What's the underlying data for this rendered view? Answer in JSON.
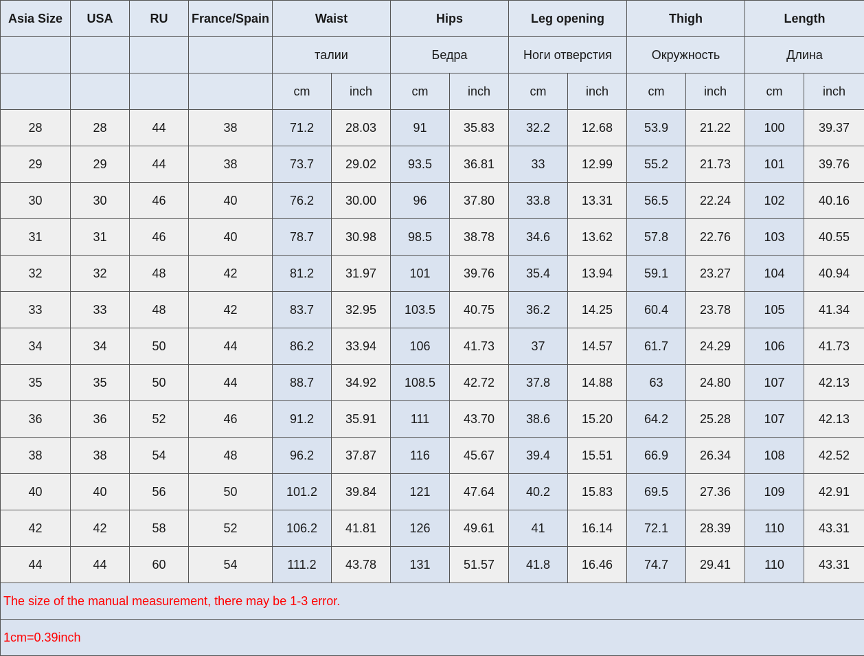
{
  "colors": {
    "header_bg": "#dfe7f2",
    "cell_gray": "#efefef",
    "cell_blue": "#dae3f0",
    "note_red": "#ff0000",
    "border": "#555555"
  },
  "header": {
    "main": [
      "Asia Size",
      "USA",
      "RU",
      "France/Spain",
      "Waist",
      "Hips",
      "Leg opening",
      "Thigh",
      "Length"
    ],
    "ru": [
      "",
      "",
      "",
      "",
      "талии",
      "Бедра",
      "Ноги отверстия",
      "Окружность",
      "Длина"
    ],
    "units": [
      "",
      "",
      "",
      "",
      "cm",
      "inch",
      "cm",
      "inch",
      "cm",
      "inch",
      "cm",
      "inch",
      "cm",
      "inch"
    ]
  },
  "rows": [
    [
      "28",
      "28",
      "44",
      "38",
      "71.2",
      "28.03",
      "91",
      "35.83",
      "32.2",
      "12.68",
      "53.9",
      "21.22",
      "100",
      "39.37"
    ],
    [
      "29",
      "29",
      "44",
      "38",
      "73.7",
      "29.02",
      "93.5",
      "36.81",
      "33",
      "12.99",
      "55.2",
      "21.73",
      "101",
      "39.76"
    ],
    [
      "30",
      "30",
      "46",
      "40",
      "76.2",
      "30.00",
      "96",
      "37.80",
      "33.8",
      "13.31",
      "56.5",
      "22.24",
      "102",
      "40.16"
    ],
    [
      "31",
      "31",
      "46",
      "40",
      "78.7",
      "30.98",
      "98.5",
      "38.78",
      "34.6",
      "13.62",
      "57.8",
      "22.76",
      "103",
      "40.55"
    ],
    [
      "32",
      "32",
      "48",
      "42",
      "81.2",
      "31.97",
      "101",
      "39.76",
      "35.4",
      "13.94",
      "59.1",
      "23.27",
      "104",
      "40.94"
    ],
    [
      "33",
      "33",
      "48",
      "42",
      "83.7",
      "32.95",
      "103.5",
      "40.75",
      "36.2",
      "14.25",
      "60.4",
      "23.78",
      "105",
      "41.34"
    ],
    [
      "34",
      "34",
      "50",
      "44",
      "86.2",
      "33.94",
      "106",
      "41.73",
      "37",
      "14.57",
      "61.7",
      "24.29",
      "106",
      "41.73"
    ],
    [
      "35",
      "35",
      "50",
      "44",
      "88.7",
      "34.92",
      "108.5",
      "42.72",
      "37.8",
      "14.88",
      "63",
      "24.80",
      "107",
      "42.13"
    ],
    [
      "36",
      "36",
      "52",
      "46",
      "91.2",
      "35.91",
      "111",
      "43.70",
      "38.6",
      "15.20",
      "64.2",
      "25.28",
      "107",
      "42.13"
    ],
    [
      "38",
      "38",
      "54",
      "48",
      "96.2",
      "37.87",
      "116",
      "45.67",
      "39.4",
      "15.51",
      "66.9",
      "26.34",
      "108",
      "42.52"
    ],
    [
      "40",
      "40",
      "56",
      "50",
      "101.2",
      "39.84",
      "121",
      "47.64",
      "40.2",
      "15.83",
      "69.5",
      "27.36",
      "109",
      "42.91"
    ],
    [
      "42",
      "42",
      "58",
      "52",
      "106.2",
      "41.81",
      "126",
      "49.61",
      "41",
      "16.14",
      "72.1",
      "28.39",
      "110",
      "43.31"
    ],
    [
      "44",
      "44",
      "60",
      "54",
      "111.2",
      "43.78",
      "131",
      "51.57",
      "41.8",
      "16.46",
      "74.7",
      "29.41",
      "110",
      "43.31"
    ]
  ],
  "notes": {
    "error": "The size of the manual measurement, there may be 1-3 error.",
    "conversion": "1cm=0.39inch"
  }
}
